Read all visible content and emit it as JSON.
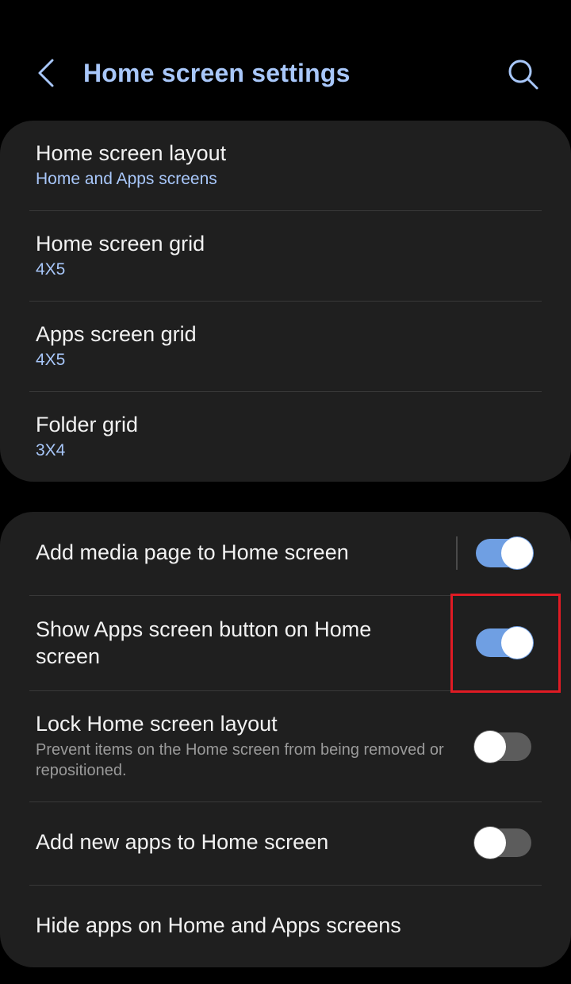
{
  "header": {
    "title": "Home screen settings",
    "back_icon": "chevron-left-icon",
    "search_icon": "search-icon"
  },
  "grid_settings": [
    {
      "title": "Home screen layout",
      "value": "Home and Apps screens"
    },
    {
      "title": "Home screen grid",
      "value": "4X5"
    },
    {
      "title": "Apps screen grid",
      "value": "4X5"
    },
    {
      "title": "Folder grid",
      "value": "3X4"
    }
  ],
  "toggle_settings": [
    {
      "title": "Add media page to Home screen",
      "description": "",
      "on": true
    },
    {
      "title": "Show Apps screen button on Home screen",
      "description": "",
      "on": true
    },
    {
      "title": "Lock Home screen layout",
      "description": "Prevent items on the Home screen from being removed or repositioned.",
      "on": false
    },
    {
      "title": "Add new apps to Home screen",
      "description": "",
      "on": false
    }
  ],
  "hide_apps": {
    "title": "Hide apps on Home and Apps screens"
  },
  "colors": {
    "background": "#000000",
    "card": "#1f1f1f",
    "accent": "#a8c7fa",
    "toggle_on": "#6f9fe3",
    "toggle_off": "#5c5c5c",
    "highlight": "#e01b24"
  }
}
